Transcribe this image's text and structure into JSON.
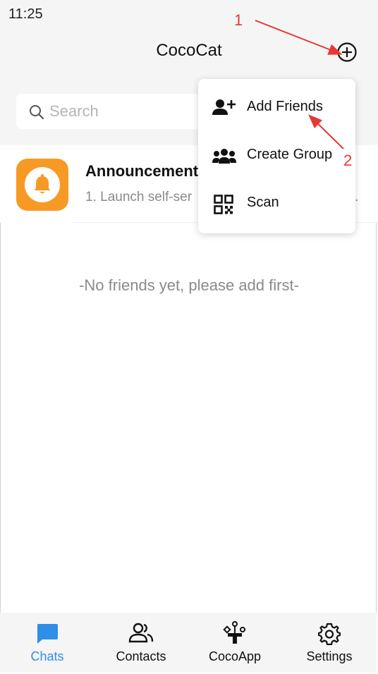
{
  "status": {
    "time": "11:25"
  },
  "header": {
    "title": "CocoCat"
  },
  "search": {
    "placeholder": "Search"
  },
  "announcement": {
    "title": "Announcement",
    "preview": "1. Launch self-ser",
    "ellipsis": ".",
    "avatar_color": "#f79a25"
  },
  "empty_message": "-No friends yet, please add first-",
  "menu": {
    "items": [
      {
        "label": "Add Friends",
        "icon": "add-person-icon"
      },
      {
        "label": "Create Group",
        "icon": "group-icon"
      },
      {
        "label": "Scan",
        "icon": "qr-scan-icon"
      }
    ]
  },
  "annotations": {
    "one": "1",
    "two": "2",
    "color": "#e53935"
  },
  "tabs": [
    {
      "label": "Chats",
      "icon": "chat-bubble-icon",
      "active": true
    },
    {
      "label": "Contacts",
      "icon": "contacts-icon",
      "active": false
    },
    {
      "label": "CocoApp",
      "icon": "apps-icon",
      "active": false
    },
    {
      "label": "Settings",
      "icon": "gear-icon",
      "active": false
    }
  ],
  "colors": {
    "accent": "#2f8ee6",
    "header_bg": "#f5f5f5"
  }
}
